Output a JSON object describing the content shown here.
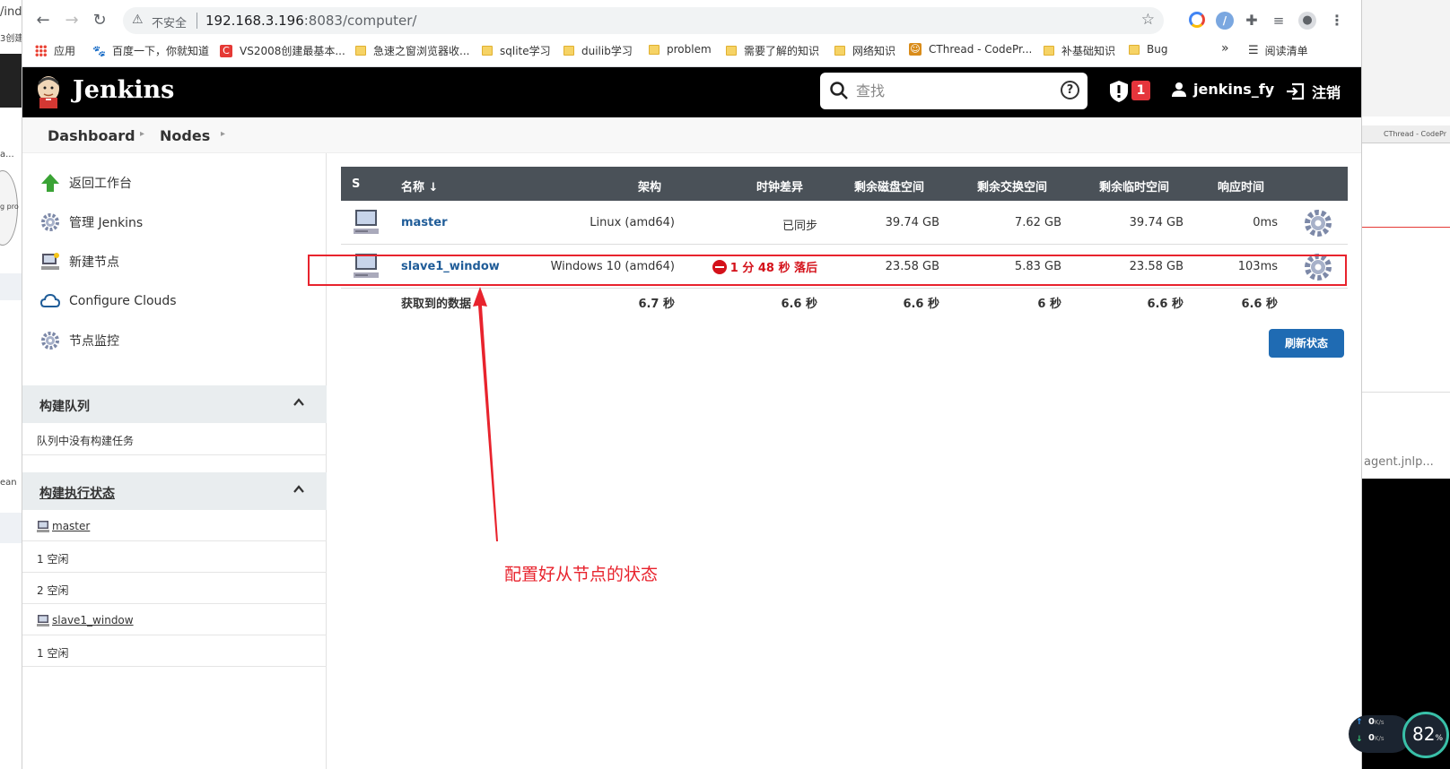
{
  "background": {
    "left_fragments": [
      "/ind",
      "3创建",
      "a...",
      "g pro",
      "ean"
    ],
    "right_fragments": [
      "CThread - CodePr",
      "agent.jnlp..."
    ]
  },
  "browser": {
    "insecure_label": "不安全",
    "url_host": "192.168.3.196",
    "url_rest": ":8083/computer/",
    "bookmarks": [
      {
        "label": "应用",
        "kind": "apps"
      },
      {
        "label": "百度一下，你就知道",
        "kind": "paw"
      },
      {
        "label": "VS2008创建最基本...",
        "kind": "c"
      },
      {
        "label": "急速之窗浏览器收...",
        "kind": "folder"
      },
      {
        "label": "sqlite学习",
        "kind": "folder"
      },
      {
        "label": "duilib学习",
        "kind": "folder"
      },
      {
        "label": "problem",
        "kind": "folder"
      },
      {
        "label": "需要了解的知识",
        "kind": "folder"
      },
      {
        "label": "网络知识",
        "kind": "folder"
      },
      {
        "label": "CThread - CodePr...",
        "kind": "site"
      },
      {
        "label": "补基础知识",
        "kind": "folder"
      },
      {
        "label": "Bug",
        "kind": "folder"
      }
    ],
    "more_label": "»",
    "reading_list": "阅读清单"
  },
  "header": {
    "brand": "Jenkins",
    "search_placeholder": "查找",
    "security_count": "1",
    "username": "jenkins_fy",
    "logout": "注销"
  },
  "breadcrumbs": [
    "Dashboard",
    "Nodes"
  ],
  "sidebar": {
    "tasks": [
      {
        "label": "返回工作台",
        "icon": "up-arrow-icon"
      },
      {
        "label": "管理 Jenkins",
        "icon": "gear-icon"
      },
      {
        "label": "新建节点",
        "icon": "computer-icon"
      },
      {
        "label": "Configure Clouds",
        "icon": "cloud-icon"
      },
      {
        "label": "节点监控",
        "icon": "gear-icon"
      }
    ],
    "build_queue": {
      "title": "构建队列",
      "empty_text": "队列中没有构建任务"
    },
    "executors": {
      "title": "构建执行状态",
      "rows": [
        "master",
        "1  空闲",
        "2  空闲",
        "slave1_window",
        "1  空闲"
      ]
    }
  },
  "table": {
    "headers": [
      "S",
      "名称 ↓",
      "架构",
      "时钟差异",
      "剩余磁盘空间",
      "剩余交换空间",
      "剩余临时空间",
      "响应时间"
    ],
    "rows": [
      {
        "name": "master",
        "arch": "Linux (amd64)",
        "clock": "已同步",
        "disk": "39.74 GB",
        "swap": "7.62 GB",
        "temp": "39.74 GB",
        "response": "0ms"
      },
      {
        "name": "slave1_window",
        "arch": "Windows 10 (amd64)",
        "clock": "1 分 48 秒 落后",
        "disk": "23.58 GB",
        "swap": "5.83 GB",
        "temp": "23.58 GB",
        "response": "103ms"
      }
    ],
    "footer": {
      "label": "获取到的数据",
      "arch": "6.7 秒",
      "clock": "6.6 秒",
      "disk": "6.6 秒",
      "swap": "6 秒",
      "temp": "6.6 秒",
      "response": "6.6 秒"
    },
    "refresh_button": "刷新状态"
  },
  "annotation": {
    "text": "配置好从节点的状态",
    "color": "#e8232d"
  },
  "net_widget": {
    "up": "0",
    "down": "0",
    "unit": "K/s",
    "percent": "82",
    "percent_sign": "%"
  },
  "colors": {
    "header_bg": "#000000",
    "table_header_bg": "#4a5158",
    "link": "#1f5c98",
    "badge_red": "#e5353c",
    "button_blue": "#1f6bb3"
  }
}
